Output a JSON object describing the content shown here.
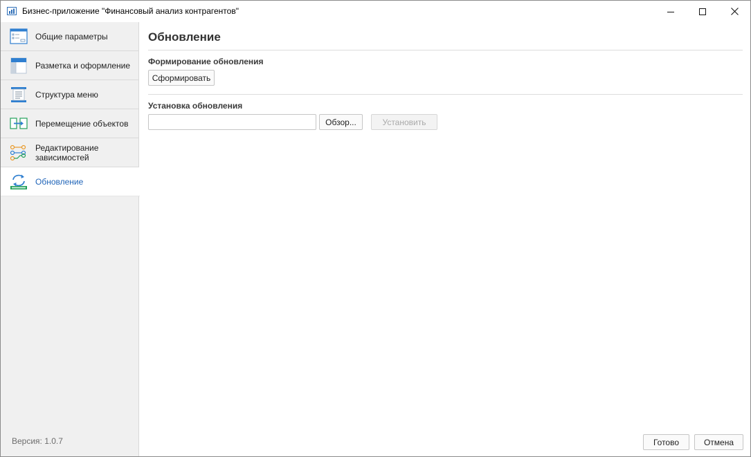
{
  "window": {
    "title": "Бизнес-приложение \"Финансовый анализ контрагентов\""
  },
  "sidebar": {
    "items": [
      {
        "label": "Общие параметры",
        "icon": "general-settings-icon"
      },
      {
        "label": "Разметка и оформление",
        "icon": "layout-icon"
      },
      {
        "label": "Структура меню",
        "icon": "menu-structure-icon"
      },
      {
        "label": "Перемещение объектов",
        "icon": "move-objects-icon"
      },
      {
        "label": "Редактирование зависимостей",
        "icon": "dependencies-icon"
      },
      {
        "label": "Обновление",
        "icon": "update-icon",
        "active": true
      }
    ],
    "version": "Версия: 1.0.7"
  },
  "main": {
    "title": "Обновление",
    "build_section": {
      "title": "Формирование обновления",
      "button": "Сформировать"
    },
    "install_section": {
      "title": "Установка обновления",
      "path_value": "",
      "browse_button": "Обзор...",
      "install_button": "Установить"
    }
  },
  "footer": {
    "ok_button": "Готово",
    "cancel_button": "Отмена"
  },
  "colors": {
    "accent": "#1f64b8",
    "sidebar_bg": "#f0f0f0",
    "icon_blue": "#2f7fd0",
    "icon_green": "#23a05a",
    "icon_orange": "#e89a2a"
  }
}
